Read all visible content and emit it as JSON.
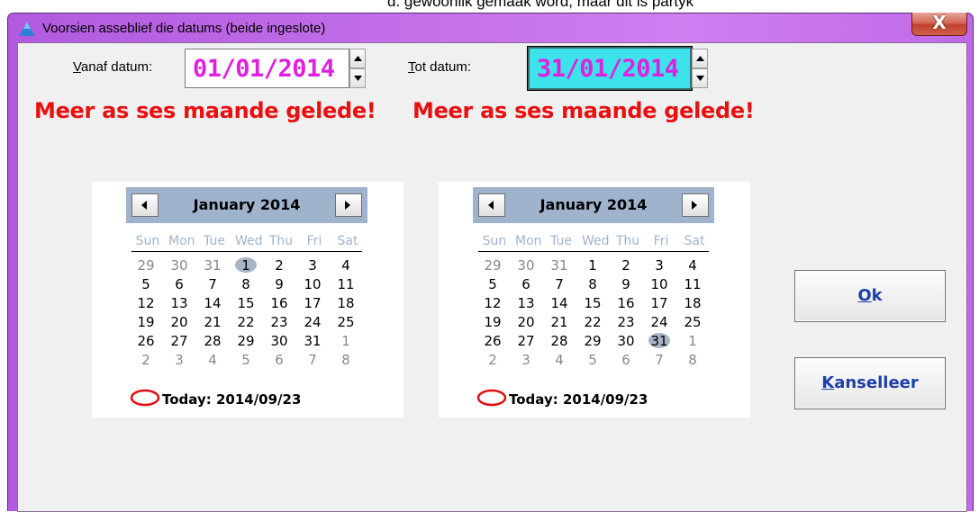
{
  "background_partial_text": "d. gewoonlik gemaak word, maar dit is partyk",
  "window": {
    "title": "Voorsien asseblief die datums (beide ingeslote)",
    "close_label": "X"
  },
  "from": {
    "label_mnemonic": "V",
    "label_rest": "anaf datum:",
    "value": "01/01/2014",
    "warning": "Meer as ses maande gelede!"
  },
  "to": {
    "label_mnemonic": "T",
    "label_rest": "ot datum:",
    "value": "31/01/2014",
    "warning": "Meer as ses maande gelede!"
  },
  "calendars": [
    {
      "month": "January 2014",
      "days_of_week": [
        "Sun",
        "Mon",
        "Tue",
        "Wed",
        "Thu",
        "Fri",
        "Sat"
      ],
      "weeks": [
        [
          "29",
          "30",
          "31",
          "1",
          "2",
          "3",
          "4"
        ],
        [
          "5",
          "6",
          "7",
          "8",
          "9",
          "10",
          "11"
        ],
        [
          "12",
          "13",
          "14",
          "15",
          "16",
          "17",
          "18"
        ],
        [
          "19",
          "20",
          "21",
          "22",
          "23",
          "24",
          "25"
        ],
        [
          "26",
          "27",
          "28",
          "29",
          "30",
          "31",
          "1"
        ],
        [
          "2",
          "3",
          "4",
          "5",
          "6",
          "7",
          "8"
        ]
      ],
      "selected_day": "1",
      "today": "Today: 2014/09/23"
    },
    {
      "month": "January 2014",
      "days_of_week": [
        "Sun",
        "Mon",
        "Tue",
        "Wed",
        "Thu",
        "Fri",
        "Sat"
      ],
      "weeks": [
        [
          "29",
          "30",
          "31",
          "1",
          "2",
          "3",
          "4"
        ],
        [
          "5",
          "6",
          "7",
          "8",
          "9",
          "10",
          "11"
        ],
        [
          "12",
          "13",
          "14",
          "15",
          "16",
          "17",
          "18"
        ],
        [
          "19",
          "20",
          "21",
          "22",
          "23",
          "24",
          "25"
        ],
        [
          "26",
          "27",
          "28",
          "29",
          "30",
          "31",
          "1"
        ],
        [
          "2",
          "3",
          "4",
          "5",
          "6",
          "7",
          "8"
        ]
      ],
      "selected_day": "31",
      "today": "Today: 2014/09/23"
    }
  ],
  "buttons": {
    "ok_mnemonic": "O",
    "ok_rest": "k",
    "cancel_mnemonic": "K",
    "cancel_rest": "anselleer"
  },
  "colors": {
    "accent_magenta": "#e020e0",
    "warning_red": "#e81010",
    "focus_cyan": "#3de3ea",
    "calendar_header": "#9fb3cc",
    "button_text_blue": "#1e3fa8"
  }
}
